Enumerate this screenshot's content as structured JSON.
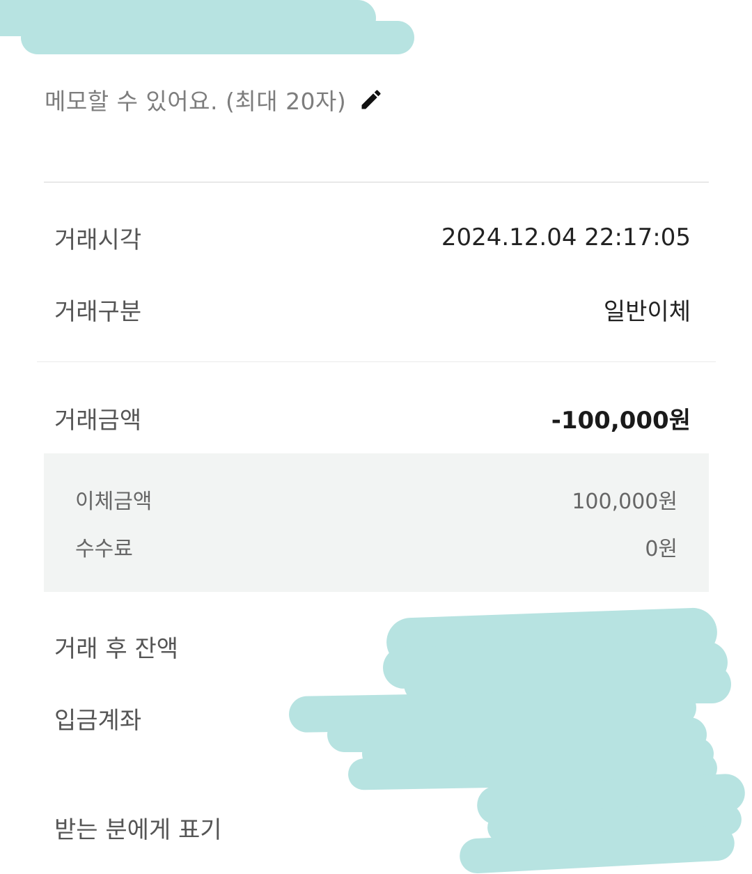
{
  "memo": {
    "placeholder": "메모할 수 있어요. (최대 20자)",
    "edit_icon": "pencil-icon"
  },
  "details": {
    "time_label": "거래시각",
    "time_value": "2024.12.04 22:17:05",
    "type_label": "거래구분",
    "type_value": "일반이체",
    "amount_label": "거래금액",
    "amount_value": "-100,000원",
    "balance_label": "거래 후 잔액",
    "account_label": "입금계좌",
    "display_label": "받는 분에게 표기"
  },
  "breakdown": {
    "transfer_label": "이체금액",
    "transfer_value": "100,000원",
    "fee_label": "수수료",
    "fee_value": "0원"
  },
  "colors": {
    "redaction": "#b7e3e1",
    "detail_background": "#f2f4f3"
  }
}
